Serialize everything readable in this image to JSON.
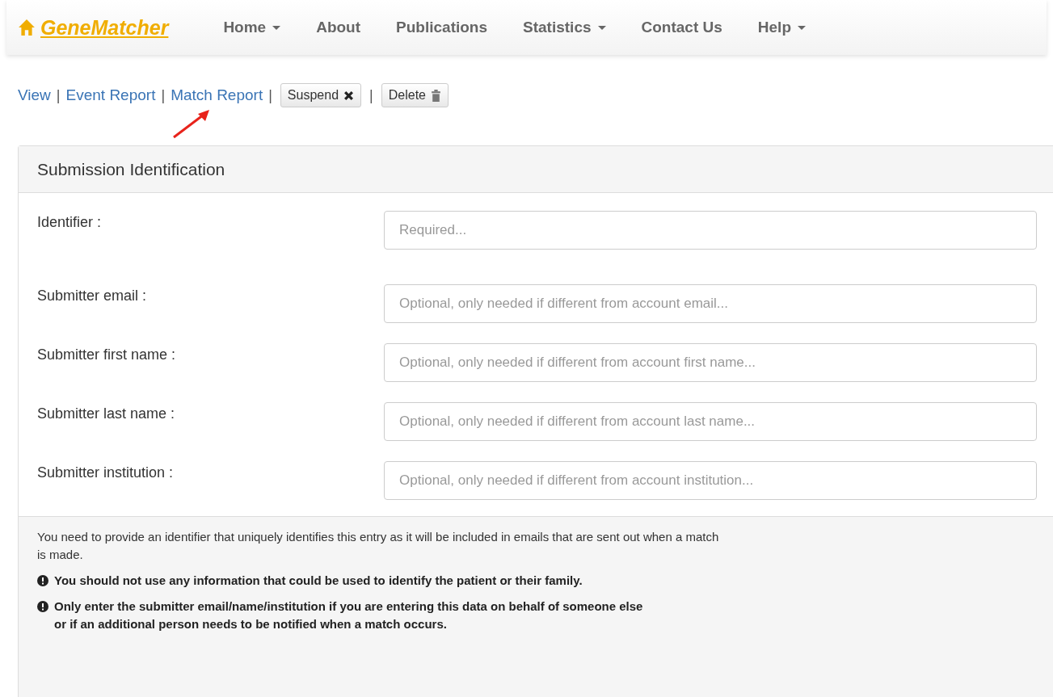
{
  "navbar": {
    "brand": "GeneMatcher",
    "items": [
      {
        "label": "Home",
        "dropdown": true
      },
      {
        "label": "About",
        "dropdown": false
      },
      {
        "label": "Publications",
        "dropdown": false
      },
      {
        "label": "Statistics",
        "dropdown": true
      },
      {
        "label": "Contact Us",
        "dropdown": false
      },
      {
        "label": "Help",
        "dropdown": true
      }
    ]
  },
  "actions": [
    {
      "kind": "link",
      "label": "View"
    },
    {
      "kind": "separator",
      "label": "|"
    },
    {
      "kind": "link",
      "label": "Event Report"
    },
    {
      "kind": "separator",
      "label": "|"
    },
    {
      "kind": "link",
      "label": "Match Report"
    },
    {
      "kind": "separator",
      "label": "|"
    },
    {
      "kind": "suspend",
      "label": "Suspend"
    },
    {
      "kind": "separator",
      "label": "|"
    },
    {
      "kind": "delete",
      "label": "Delete"
    }
  ],
  "panel": {
    "title": "Submission Identification",
    "fields": [
      {
        "label": "Identifier :",
        "placeholder": "Required..."
      },
      {
        "label": "Submitter email :",
        "placeholder": "Optional, only needed if different from account email..."
      },
      {
        "label": "Submitter first name :",
        "placeholder": "Optional, only needed if different from account first name..."
      },
      {
        "label": "Submitter last name :",
        "placeholder": "Optional, only needed if different from account last name..."
      },
      {
        "label": "Submitter institution :",
        "placeholder": "Optional, only needed if different from account institution..."
      }
    ],
    "notes": [
      {
        "kind": "plain",
        "lines": [
          "You need to provide an identifier that uniquely identifies this entry as it will be included in emails that are sent out when a match",
          "is made."
        ]
      },
      {
        "kind": "warning",
        "lines": [
          "You should not use any information that could be used to identify the patient or their family."
        ]
      },
      {
        "kind": "warning",
        "lines": [
          "Only enter the submitter email/name/institution if you are entering this data on behalf of someone else",
          "or if an additional person needs to be notified when a match occurs."
        ]
      }
    ]
  }
}
